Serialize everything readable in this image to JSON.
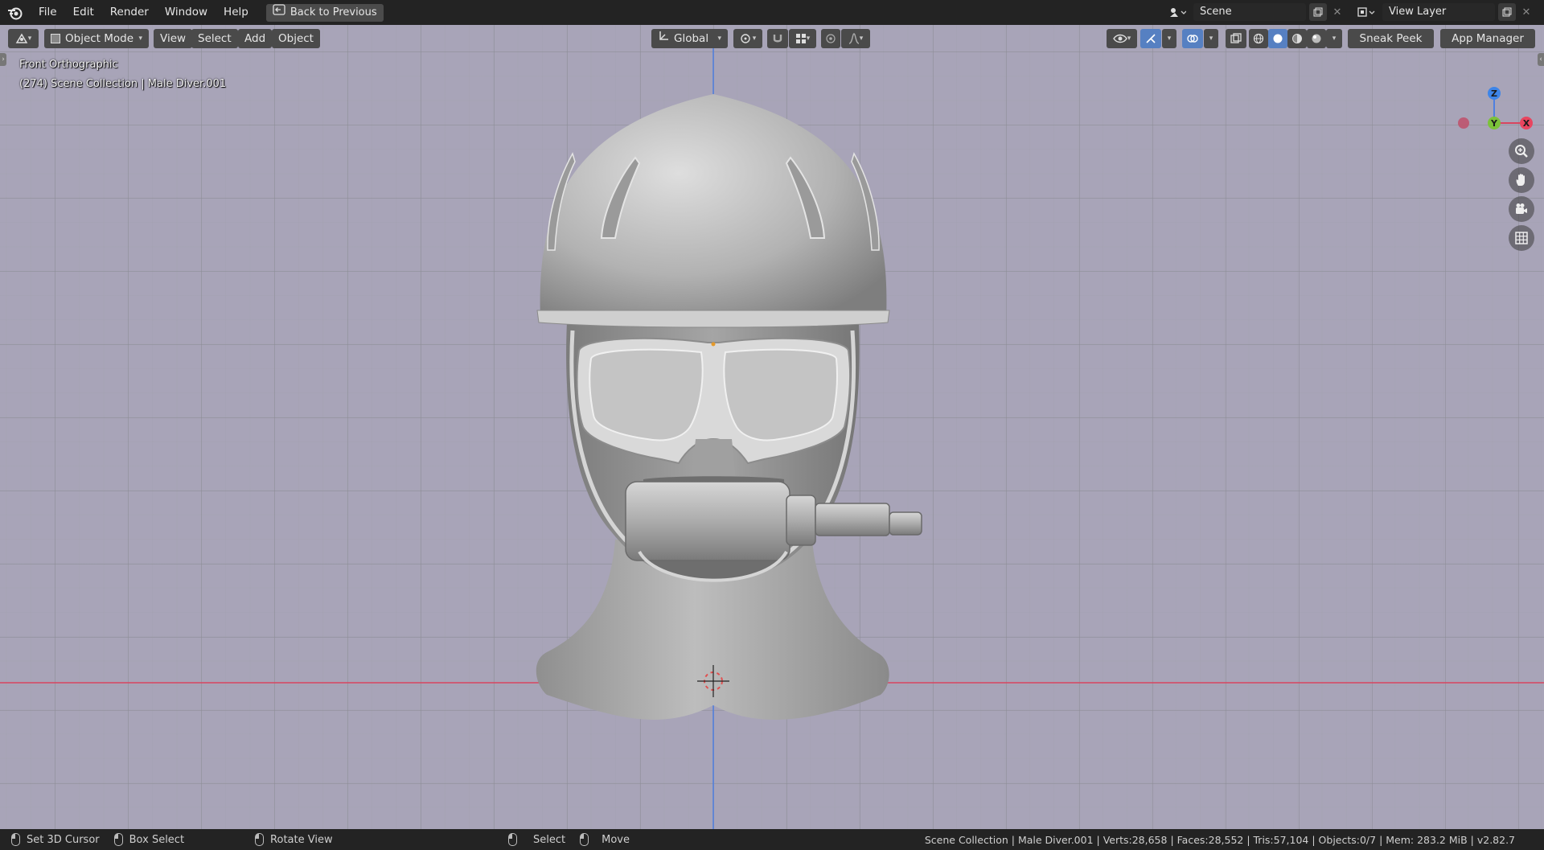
{
  "topbar": {
    "menus": [
      "File",
      "Edit",
      "Render",
      "Window",
      "Help"
    ],
    "back_button": "Back to Previous",
    "scene_field": "Scene",
    "view_layer_field": "View Layer"
  },
  "header": {
    "mode": "Object Mode",
    "menus": [
      "View",
      "Select",
      "Add",
      "Object"
    ],
    "transform_orientation": "Global",
    "sneak_peek": "Sneak Peek",
    "app_manager": "App Manager"
  },
  "viewport": {
    "view_name": "Front Orthographic",
    "collection_info": "(274) Scene Collection | Male Diver.001",
    "gizmo": {
      "z": "Z",
      "y": "Y",
      "x": "X"
    },
    "colors": {
      "background": "#a8a4b8",
      "x_axis": "#d8455f",
      "z_axis": "#4f7fe0",
      "model": "#b4b4b4"
    }
  },
  "statusbar": {
    "left_items": [
      {
        "icon": "mouse-left-icon",
        "label": "Set 3D Cursor"
      },
      {
        "icon": "mouse-drag-icon",
        "label": "Box Select"
      },
      {
        "icon": "mouse-middle-icon",
        "label": "Rotate View"
      }
    ],
    "mid_items": [
      {
        "icon": "mouse-left-icon",
        "label": "Select"
      },
      {
        "icon": "mouse-drag-icon",
        "label": "Move"
      }
    ],
    "stats": "Scene Collection | Male Diver.001 | Verts:28,658 | Faces:28,552 | Tris:57,104 | Objects:0/7 | Mem: 283.2 MiB | v2.82.7"
  }
}
